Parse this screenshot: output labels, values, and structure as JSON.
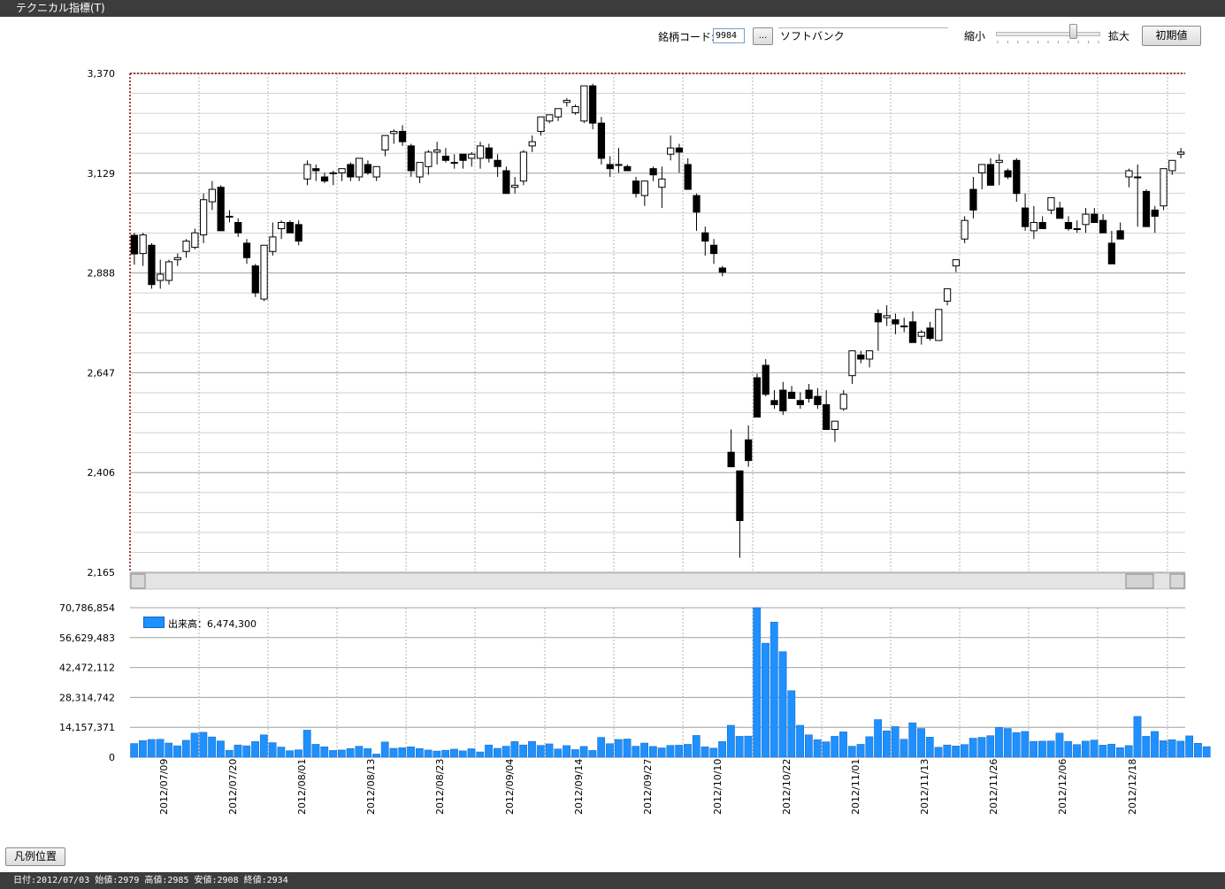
{
  "window": {
    "title": "テクニカル指標(T)"
  },
  "toolbar": {
    "code_label": "銘柄コード:",
    "code_value": "9984",
    "browse_label": "...",
    "name_value": "ソフトバンク",
    "zoom_out_label": "縮小",
    "zoom_in_label": "拡大",
    "reset_label": "初期値",
    "zoom_level": 0.75
  },
  "legend_button": {
    "label": "凡例位置"
  },
  "legend": {
    "label": "出来高：",
    "value": "6,474,300"
  },
  "status": {
    "text": "日付:2012/07/03 始値:2979 高値:2985 安値:2908 終値:2934"
  },
  "colors": {
    "volume": "#1e90ff",
    "bear": "#000000",
    "bull": "#ffffff",
    "accent": "#8b0000"
  },
  "chart_data": [
    {
      "type": "candlestick",
      "ylim": [
        2165,
        3370
      ],
      "yticks": [
        "3,370",
        "3,129",
        "2,888",
        "2,647",
        "2,406",
        "2,165"
      ],
      "dates": [
        "2012/07/09",
        "2012/07/20",
        "2012/08/01",
        "2012/08/13",
        "2012/08/23",
        "2012/09/04",
        "2012/09/14",
        "2012/09/27",
        "2012/10/10",
        "2012/10/22",
        "2012/11/01",
        "2012/11/13",
        "2012/11/26",
        "2012/12/06",
        "2012/12/18"
      ],
      "candles": [
        [
          2979,
          2985,
          2908,
          2934
        ],
        [
          2935,
          2985,
          2905,
          2980
        ],
        [
          2955,
          2960,
          2850,
          2860
        ],
        [
          2870,
          2920,
          2850,
          2885
        ],
        [
          2870,
          2920,
          2860,
          2915
        ],
        [
          2920,
          2935,
          2905,
          2925
        ],
        [
          2940,
          2970,
          2925,
          2965
        ],
        [
          2950,
          2995,
          2945,
          2985
        ],
        [
          2980,
          3080,
          2960,
          3065
        ],
        [
          3060,
          3110,
          3040,
          3090
        ],
        [
          3095,
          3100,
          2990,
          2990
        ],
        [
          3025,
          3040,
          3010,
          3025
        ],
        [
          3010,
          3020,
          2975,
          2985
        ],
        [
          2960,
          2970,
          2910,
          2925
        ],
        [
          2905,
          2910,
          2830,
          2840
        ],
        [
          2825,
          2940,
          2820,
          2955
        ],
        [
          2940,
          3010,
          2930,
          2975
        ],
        [
          2995,
          3015,
          2970,
          3010
        ],
        [
          3010,
          3015,
          2990,
          2985
        ],
        [
          3005,
          3015,
          2955,
          2965
        ],
        [
          3115,
          3160,
          3100,
          3150
        ],
        [
          3140,
          3150,
          3110,
          3135
        ],
        [
          3120,
          3130,
          3105,
          3110
        ],
        [
          3130,
          3135,
          3100,
          3130
        ],
        [
          3130,
          3140,
          3110,
          3140
        ],
        [
          3150,
          3155,
          3110,
          3120
        ],
        [
          3120,
          3160,
          3110,
          3165
        ],
        [
          3150,
          3160,
          3125,
          3130
        ],
        [
          3120,
          3140,
          3110,
          3145
        ],
        [
          3185,
          3220,
          3170,
          3220
        ],
        [
          3225,
          3235,
          3200,
          3230
        ],
        [
          3230,
          3245,
          3195,
          3205
        ],
        [
          3195,
          3200,
          3120,
          3135
        ],
        [
          3120,
          3155,
          3105,
          3155
        ],
        [
          3145,
          3185,
          3125,
          3180
        ],
        [
          3180,
          3205,
          3150,
          3185
        ],
        [
          3170,
          3190,
          3155,
          3160
        ],
        [
          3155,
          3175,
          3140,
          3155
        ],
        [
          3175,
          3175,
          3140,
          3160
        ],
        [
          3165,
          3180,
          3145,
          3175
        ],
        [
          3165,
          3205,
          3140,
          3195
        ],
        [
          3190,
          3200,
          3155,
          3165
        ],
        [
          3160,
          3175,
          3120,
          3145
        ],
        [
          3135,
          3145,
          3090,
          3080
        ],
        [
          3095,
          3120,
          3080,
          3100
        ],
        [
          3110,
          3185,
          3100,
          3180
        ],
        [
          3195,
          3220,
          3180,
          3205
        ],
        [
          3230,
          3260,
          3220,
          3265
        ],
        [
          3255,
          3270,
          3250,
          3270
        ],
        [
          3265,
          3280,
          3255,
          3285
        ],
        [
          3300,
          3310,
          3290,
          3305
        ],
        [
          3275,
          3295,
          3270,
          3290
        ],
        [
          3255,
          3335,
          3250,
          3340
        ],
        [
          3340,
          3345,
          3235,
          3250
        ],
        [
          3250,
          3265,
          3150,
          3165
        ],
        [
          3150,
          3170,
          3120,
          3140
        ],
        [
          3150,
          3190,
          3130,
          3150
        ],
        [
          3145,
          3150,
          3135,
          3135
        ],
        [
          3110,
          3120,
          3070,
          3080
        ],
        [
          3075,
          3110,
          3050,
          3110
        ],
        [
          3140,
          3145,
          3110,
          3125
        ],
        [
          3095,
          3145,
          3045,
          3115
        ],
        [
          3175,
          3220,
          3160,
          3190
        ],
        [
          3190,
          3200,
          3130,
          3180
        ],
        [
          3150,
          3165,
          3090,
          3090
        ],
        [
          3075,
          3080,
          2990,
          3035
        ],
        [
          2985,
          3000,
          2930,
          2965
        ],
        [
          2955,
          2970,
          2910,
          2935
        ],
        [
          2900,
          2905,
          2880,
          2890
        ],
        [
          2455,
          2510,
          2420,
          2420
        ],
        [
          2410,
          2410,
          2200,
          2290
        ],
        [
          2485,
          2520,
          2420,
          2435
        ],
        [
          2635,
          2645,
          2540,
          2540
        ],
        [
          2665,
          2680,
          2590,
          2595
        ],
        [
          2580,
          2605,
          2560,
          2570
        ],
        [
          2605,
          2625,
          2545,
          2555
        ],
        [
          2600,
          2615,
          2590,
          2585
        ],
        [
          2580,
          2600,
          2560,
          2570
        ],
        [
          2605,
          2620,
          2575,
          2585
        ],
        [
          2590,
          2610,
          2560,
          2570
        ],
        [
          2570,
          2605,
          2510,
          2510
        ],
        [
          2510,
          2530,
          2480,
          2530
        ],
        [
          2560,
          2605,
          2555,
          2595
        ],
        [
          2640,
          2690,
          2620,
          2700
        ],
        [
          2690,
          2700,
          2670,
          2680
        ],
        [
          2680,
          2695,
          2660,
          2700
        ],
        [
          2790,
          2800,
          2700,
          2770
        ],
        [
          2780,
          2810,
          2760,
          2785
        ],
        [
          2775,
          2790,
          2740,
          2765
        ],
        [
          2760,
          2780,
          2745,
          2760
        ],
        [
          2770,
          2795,
          2720,
          2720
        ],
        [
          2735,
          2750,
          2715,
          2745
        ],
        [
          2755,
          2770,
          2725,
          2730
        ],
        [
          2725,
          2735,
          2725,
          2800
        ],
        [
          2820,
          2830,
          2810,
          2850
        ],
        [
          2905,
          2920,
          2890,
          2920
        ],
        [
          2970,
          3025,
          2960,
          3015
        ],
        [
          3090,
          3120,
          3020,
          3040
        ],
        [
          3130,
          3145,
          3090,
          3150
        ],
        [
          3150,
          3165,
          3120,
          3100
        ],
        [
          3155,
          3175,
          3100,
          3160
        ],
        [
          3135,
          3140,
          3115,
          3120
        ],
        [
          3160,
          3165,
          3060,
          3080
        ],
        [
          3045,
          3080,
          2990,
          3000
        ],
        [
          2990,
          3050,
          2970,
          3010
        ],
        [
          3010,
          3025,
          2995,
          2995
        ],
        [
          3040,
          3070,
          3030,
          3070
        ],
        [
          3045,
          3060,
          3020,
          3020
        ],
        [
          3010,
          3025,
          2990,
          2995
        ],
        [
          2995,
          3015,
          2985,
          2995
        ],
        [
          3005,
          3045,
          2985,
          3030
        ],
        [
          3030,
          3045,
          3015,
          3010
        ],
        [
          3015,
          3030,
          2995,
          2985
        ],
        [
          2960,
          2990,
          2940,
          2910
        ],
        [
          2990,
          3010,
          2990,
          2970
        ],
        [
          3120,
          3140,
          3095,
          3135
        ],
        [
          3120,
          3150,
          3000,
          3120
        ],
        [
          3085,
          3090,
          3005,
          3000
        ],
        [
          3040,
          3050,
          2985,
          3025
        ],
        [
          3050,
          3060,
          3040,
          3140
        ],
        [
          3135,
          3155,
          3125,
          3160
        ],
        [
          3175,
          3190,
          3165,
          3180
        ]
      ]
    },
    {
      "type": "bar",
      "title": "出来高",
      "ylim": [
        0,
        70786854
      ],
      "yticks": [
        "70,786,854",
        "56,629,483",
        "42,472,112",
        "28,314,742",
        "14,157,371",
        "0"
      ],
      "dates": [
        "2012/07/09",
        "2012/07/20",
        "2012/08/01",
        "2012/08/13",
        "2012/08/23",
        "2012/09/04",
        "2012/09/14",
        "2012/09/27",
        "2012/10/10",
        "2012/10/22",
        "2012/11/01",
        "2012/11/13",
        "2012/11/26",
        "2012/12/06",
        "2012/12/18"
      ],
      "values": [
        6474300,
        7900000,
        8400000,
        8500000,
        6700000,
        5400000,
        8000000,
        11400000,
        11800000,
        9600000,
        7700000,
        3300000,
        5800000,
        5400000,
        7400000,
        10600000,
        6900000,
        4800000,
        3100000,
        3500000,
        12800000,
        6100000,
        4900000,
        3200000,
        3400000,
        4100000,
        5200000,
        4100000,
        1500000,
        7200000,
        4200000,
        4500000,
        4900000,
        4100000,
        3400000,
        2900000,
        3300000,
        3800000,
        3000000,
        4000000,
        2500000,
        5800000,
        4200000,
        5200000,
        7400000,
        5800000,
        7500000,
        5600000,
        6300000,
        3900000,
        5500000,
        3600000,
        5100000,
        3200000,
        9400000,
        6400000,
        8400000,
        8600000,
        5200000,
        6700000,
        5100000,
        4400000,
        5600000,
        5700000,
        6100000,
        10300000,
        4900000,
        4300000,
        7400000,
        15100000,
        9900000,
        10000000,
        70786854,
        54000000,
        64000000,
        50000000,
        31500000,
        15100000,
        10600000,
        8300000,
        7300000,
        9900000,
        12000000,
        5200000,
        6100000,
        9700000,
        17800000,
        12500000,
        14500000,
        8500000,
        16300000,
        13600000,
        9500000,
        4700000,
        5800000,
        5300000,
        6000000,
        9000000,
        9400000,
        10200000,
        14100000,
        13600000,
        11700000,
        12200000,
        7500000,
        7600000,
        7700000,
        11400000,
        7500000,
        6000000,
        7600000,
        8100000,
        5700000,
        6200000,
        4500000,
        5500000,
        19300000,
        9900000,
        12200000,
        7800000,
        8300000,
        7600000,
        10100000,
        6600000,
        5000000
      ]
    }
  ]
}
